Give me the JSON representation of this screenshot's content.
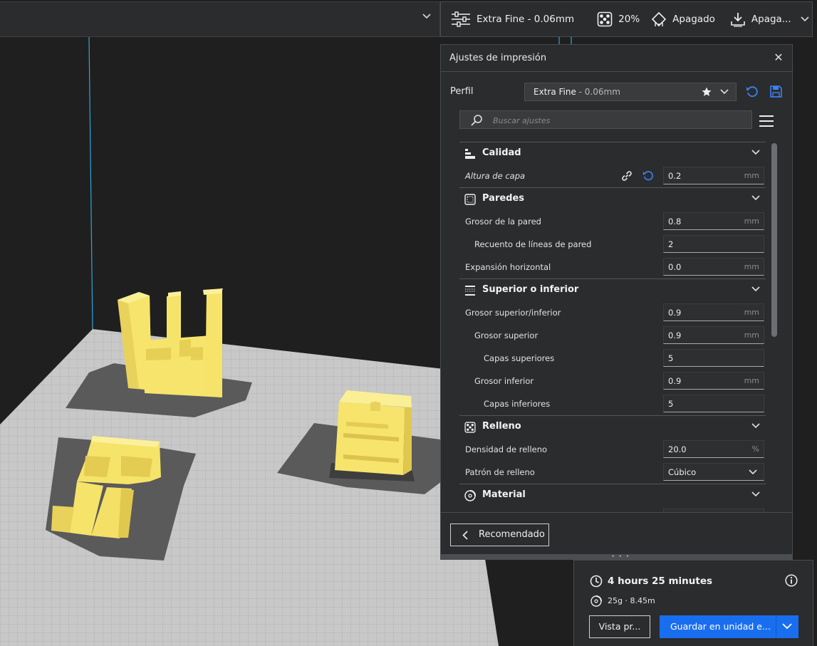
{
  "topbar": {
    "profile_label": "Extra Fine - 0.06mm",
    "infill_label": "20%",
    "support_label": "Apagado",
    "adhesion_label": "Apaga..."
  },
  "panel": {
    "title": "Ajustes de impresión",
    "profile_label": "Perfil",
    "profile_name": "Extra Fine",
    "profile_sub": " - 0.06mm",
    "search_placeholder": "Buscar ajustes",
    "categories": [
      {
        "label": "Calidad",
        "icon": "quality-icon"
      },
      {
        "label": "Paredes",
        "icon": "walls-icon"
      },
      {
        "label": "Superior o inferior",
        "icon": "top-bottom-icon"
      },
      {
        "label": "Relleno",
        "icon": "infill-icon"
      },
      {
        "label": "Material",
        "icon": "material-icon"
      }
    ],
    "settings": {
      "layer_height": {
        "label": "Altura de capa",
        "value": "0.2",
        "unit": "mm"
      },
      "wall_thickness": {
        "label": "Grosor de la pared",
        "value": "0.8",
        "unit": "mm"
      },
      "wall_line_count": {
        "label": "Recuento de líneas de pared",
        "value": "2"
      },
      "horizontal_expansion": {
        "label": "Expansión horizontal",
        "value": "0.0",
        "unit": "mm"
      },
      "top_bottom_thickness": {
        "label": "Grosor superior/inferior",
        "value": "0.9",
        "unit": "mm"
      },
      "top_thickness": {
        "label": "Grosor superior",
        "value": "0.9",
        "unit": "mm"
      },
      "top_layers": {
        "label": "Capas superiores",
        "value": "5"
      },
      "bottom_thickness": {
        "label": "Grosor inferior",
        "value": "0.9",
        "unit": "mm"
      },
      "bottom_layers": {
        "label": "Capas inferiores",
        "value": "5"
      },
      "infill_density": {
        "label": "Densidad de relleno",
        "value": "20.0",
        "unit": "%"
      },
      "infill_pattern": {
        "label": "Patrón de relleno",
        "value": "Cúbico"
      }
    },
    "recommended_label": "Recomendado"
  },
  "job": {
    "print_time": "4 hours 25 minutes",
    "material_usage": "25g · 8.45m",
    "preview_label": "Vista pr...",
    "save_label": "Guardar en unidad e..."
  },
  "colors": {
    "accent": "#196ef0",
    "model_yellow": "#f6e36a",
    "build_plate": "#c8c8c8"
  }
}
